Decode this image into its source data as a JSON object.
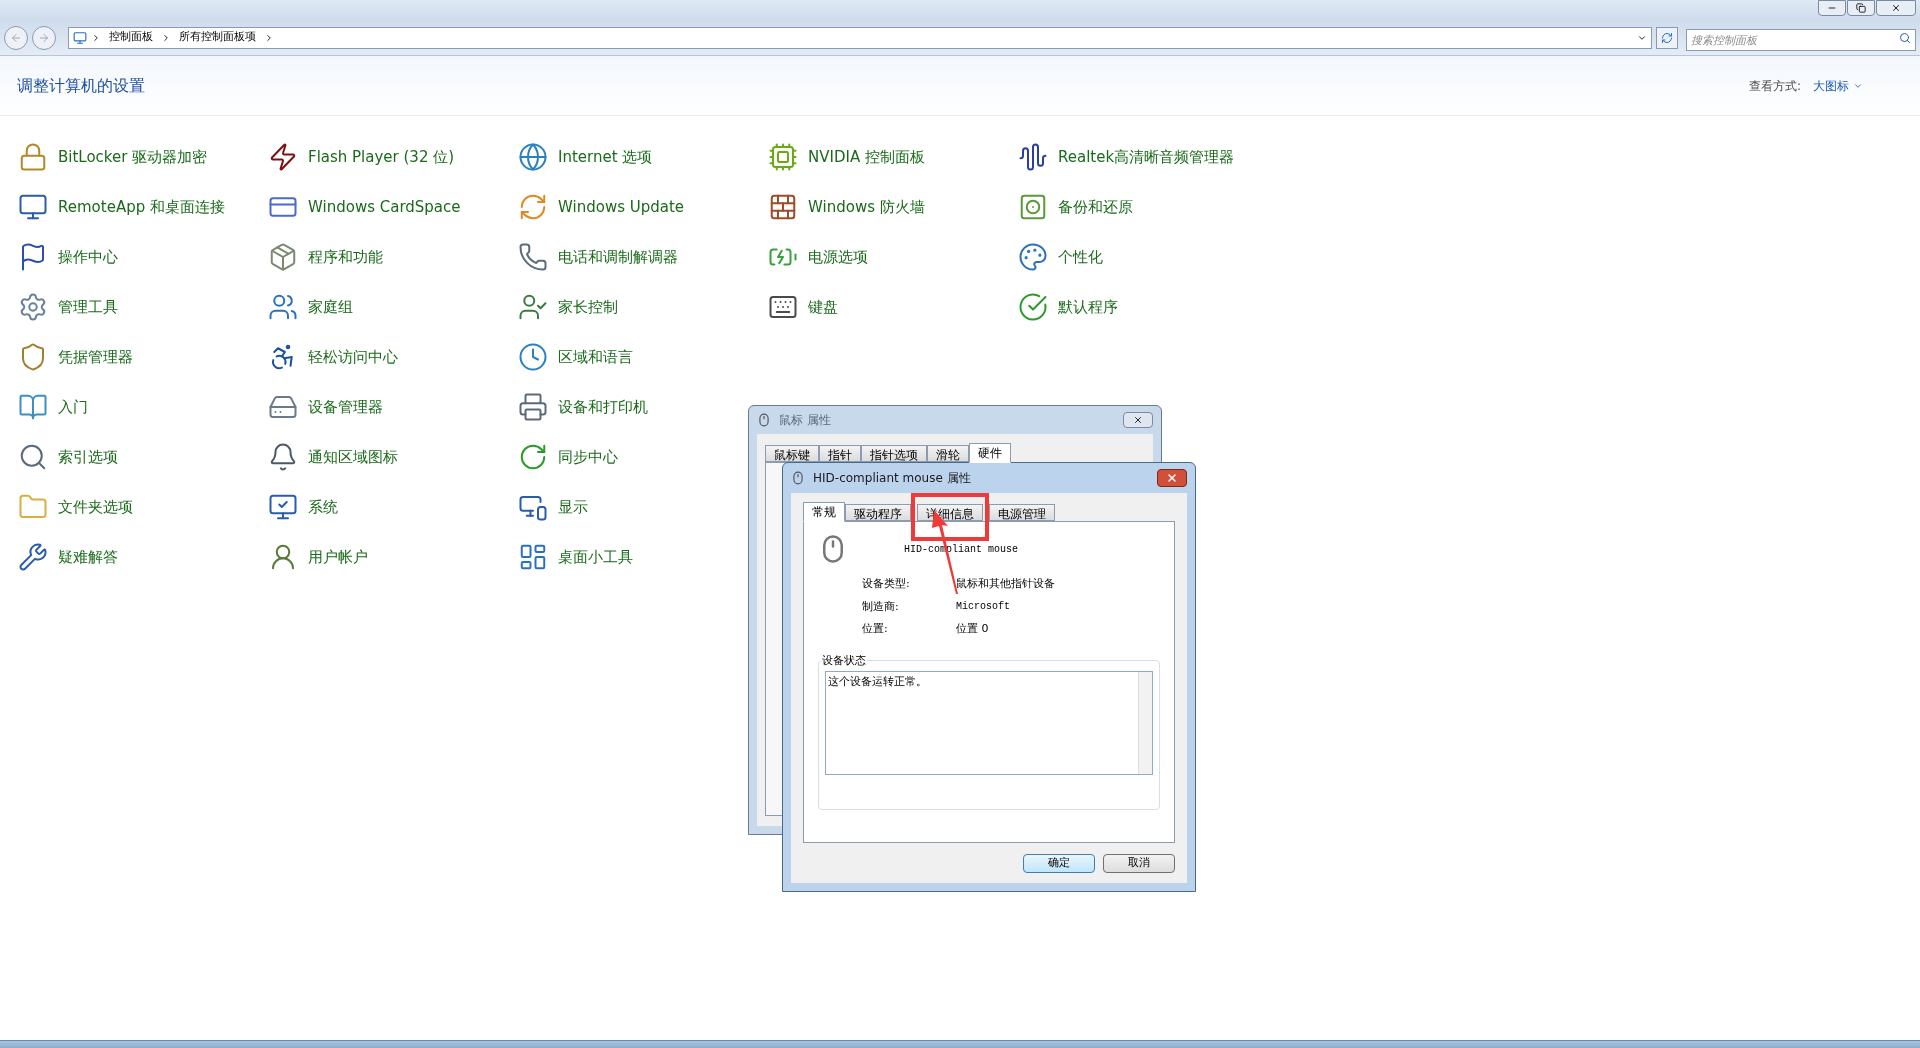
{
  "address_bar": {
    "crumbs": [
      "控制面板",
      "所有控制面板项"
    ],
    "search": {
      "placeholder": "搜索控制面板"
    }
  },
  "header": {
    "title": "调整计算机的设置",
    "view_label": "查看方式:",
    "view_value": "大图标"
  },
  "columns": [
    [
      "BitLocker 驱动器加密",
      "RemoteApp 和桌面连接",
      "操作中心",
      "管理工具",
      "凭据管理器",
      "入门",
      "索引选项",
      "文件夹选项",
      "疑难解答"
    ],
    [
      "Flash Player (32 位)",
      "Windows CardSpace",
      "程序和功能",
      "家庭组",
      "轻松访问中心",
      "设备管理器",
      "通知区域图标",
      "系统",
      "用户帐户"
    ],
    [
      "Internet 选项",
      "Windows Update",
      "电话和调制解调器",
      "家长控制",
      "区域和语言",
      "设备和打印机",
      "同步中心",
      "显示",
      "桌面小工具"
    ],
    [
      "NVIDIA 控制面板",
      "Windows 防火墙",
      "电源选项",
      "键盘"
    ],
    [
      "Realtek高清晰音频管理器",
      "备份和还原",
      "个性化",
      "默认程序"
    ]
  ],
  "mouse_dialog": {
    "title": "鼠标 属性",
    "tabs": [
      {
        "label": "鼠标键",
        "selected": false
      },
      {
        "label": "指针",
        "selected": false
      },
      {
        "label": "指针选项",
        "selected": false
      },
      {
        "label": "滑轮",
        "selected": false
      },
      {
        "label": "硬件",
        "selected": true
      }
    ]
  },
  "device_dialog": {
    "title": "HID-compliant mouse 属性",
    "tabs": [
      {
        "label": "常规",
        "selected": true
      },
      {
        "label": "驱动程序",
        "selected": false
      },
      {
        "label": "详细信息",
        "selected": false
      },
      {
        "label": "电源管理",
        "selected": false
      }
    ],
    "device_name": "HID-compliant mouse",
    "fields": [
      {
        "label": "设备类型:",
        "value": "鼠标和其他指针设备"
      },
      {
        "label": "制造商:",
        "value": "Microsoft"
      },
      {
        "label": "位置:",
        "value": "位置 0"
      }
    ],
    "status_group": "设备状态",
    "status_text": "这个设备运转正常。",
    "buttons": [
      "确定",
      "取消"
    ]
  }
}
